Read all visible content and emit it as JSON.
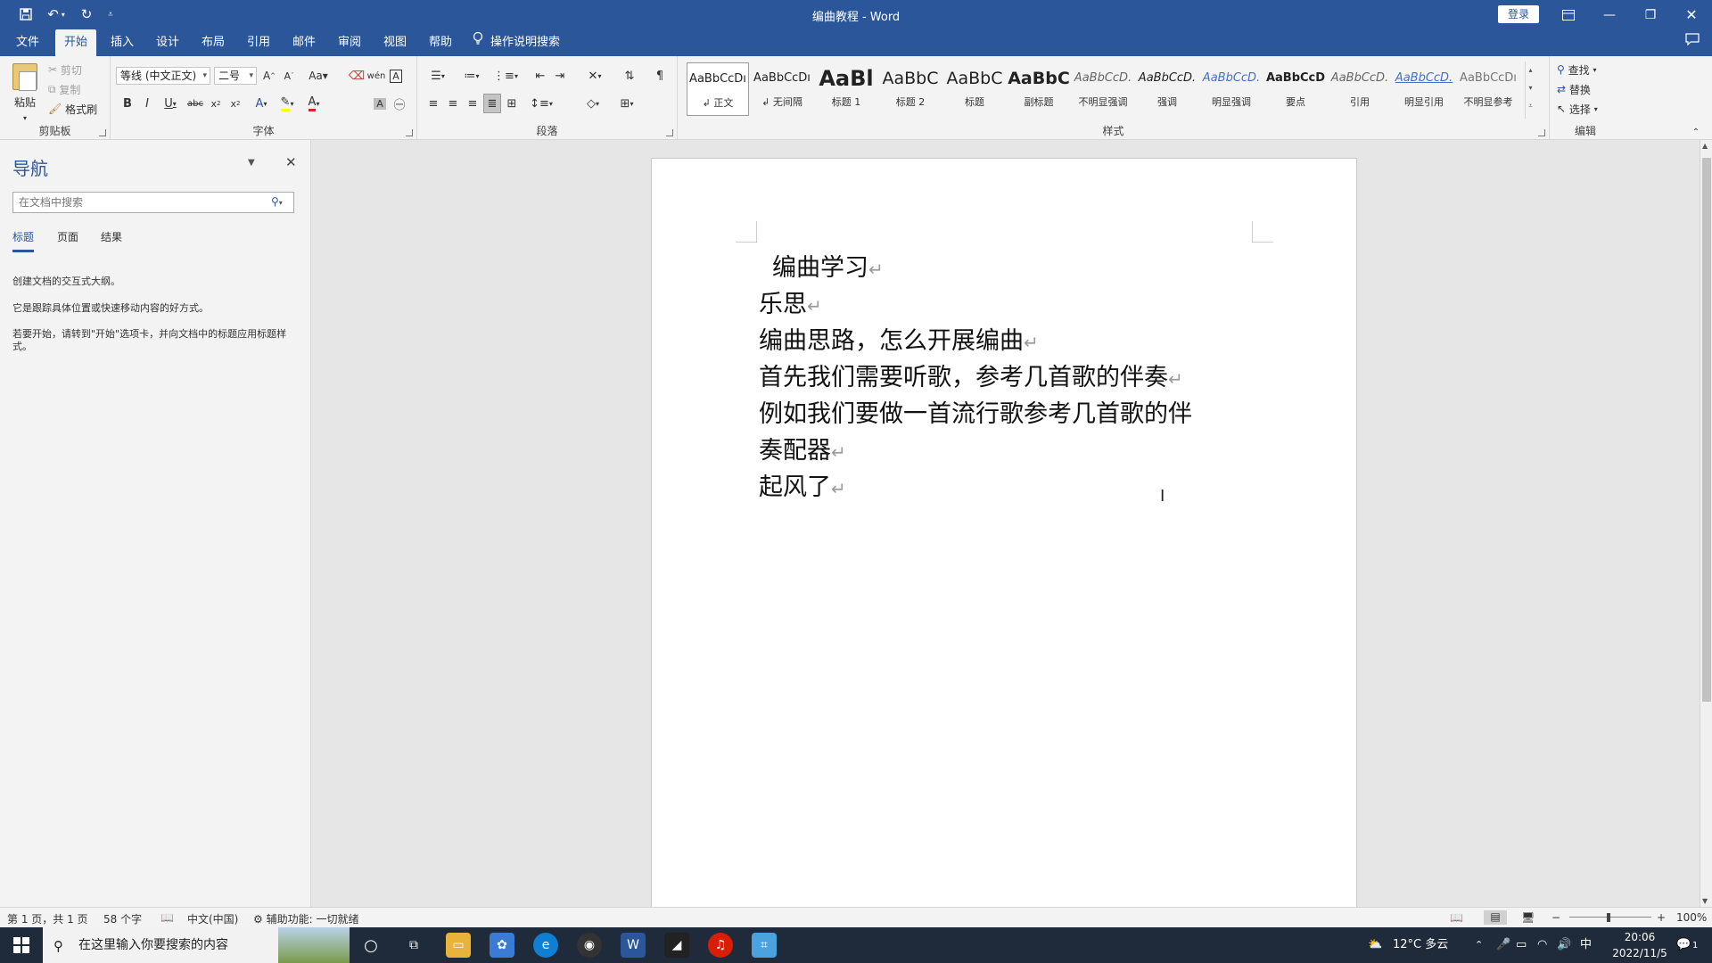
{
  "titlebar": {
    "title": "编曲教程  -  Word",
    "login": "登录"
  },
  "menu": {
    "tabs": [
      "文件",
      "开始",
      "插入",
      "设计",
      "布局",
      "引用",
      "邮件",
      "审阅",
      "视图",
      "帮助"
    ],
    "active": "开始",
    "tell_me": "操作说明搜索"
  },
  "ribbon": {
    "clipboard": {
      "paste": "粘贴",
      "cut": "剪切",
      "copy": "复制",
      "format_painter": "格式刷",
      "label": "剪贴板"
    },
    "font": {
      "font_name": "等线 (中文正文)",
      "font_size": "二号",
      "label": "字体"
    },
    "paragraph": {
      "label": "段落"
    },
    "styles": {
      "label": "样式",
      "items": [
        {
          "sample": "AaBbCcDı",
          "name": "↲ 正文"
        },
        {
          "sample": "AaBbCcDı",
          "name": "↲ 无间隔"
        },
        {
          "sample": "AaBl",
          "name": "标题 1"
        },
        {
          "sample": "AaBbC",
          "name": "标题 2"
        },
        {
          "sample": "AaBbC",
          "name": "标题"
        },
        {
          "sample": "AaBbC",
          "name": "副标题"
        },
        {
          "sample": "AaBbCcD.",
          "name": "不明显强调"
        },
        {
          "sample": "AaBbCcD.",
          "name": "强调"
        },
        {
          "sample": "AaBbCcD.",
          "name": "明显强调"
        },
        {
          "sample": "AaBbCcD",
          "name": "要点"
        },
        {
          "sample": "AaBbCcD.",
          "name": "引用"
        },
        {
          "sample": "AaBbCcD.",
          "name": "明显引用"
        },
        {
          "sample": "AaBbCcDı",
          "name": "不明显参考"
        }
      ]
    },
    "editing": {
      "find": "查找",
      "replace": "替换",
      "select": "选择",
      "label": "编辑"
    }
  },
  "nav": {
    "title": "导航",
    "search_placeholder": "在文档中搜索",
    "tabs": [
      "标题",
      "页面",
      "结果"
    ],
    "help1": "创建文档的交互式大纲。",
    "help2": "它是跟踪具体位置或快速移动内容的好方式。",
    "help3": "若要开始，请转到\"开始\"选项卡，并向文档中的标题应用标题样式。"
  },
  "document": {
    "lines": [
      "编曲学习",
      "乐思",
      "编曲思路，怎么开展编曲",
      "首先我们需要听歌，参考几首歌的伴奏",
      "例如我们要做一首流行歌参考几首歌的伴",
      "奏配器",
      "起风了"
    ],
    "paragraph_mark": "↵"
  },
  "status": {
    "page": "第 1 页，共 1 页",
    "words": "58 个字",
    "language": "中文(中国)",
    "accessibility": "辅助功能: 一切就绪",
    "zoom": "100%"
  },
  "taskbar": {
    "search_placeholder": "在这里输入你要搜索的内容",
    "weather": "12°C  多云",
    "ime": "中",
    "time": "20:06",
    "date": "2022/11/5",
    "notification_count": "1"
  },
  "colors": {
    "word_blue": "#2b579a",
    "ribbon_bg": "#f3f3f3",
    "canvas_bg": "#e6e6e6"
  }
}
